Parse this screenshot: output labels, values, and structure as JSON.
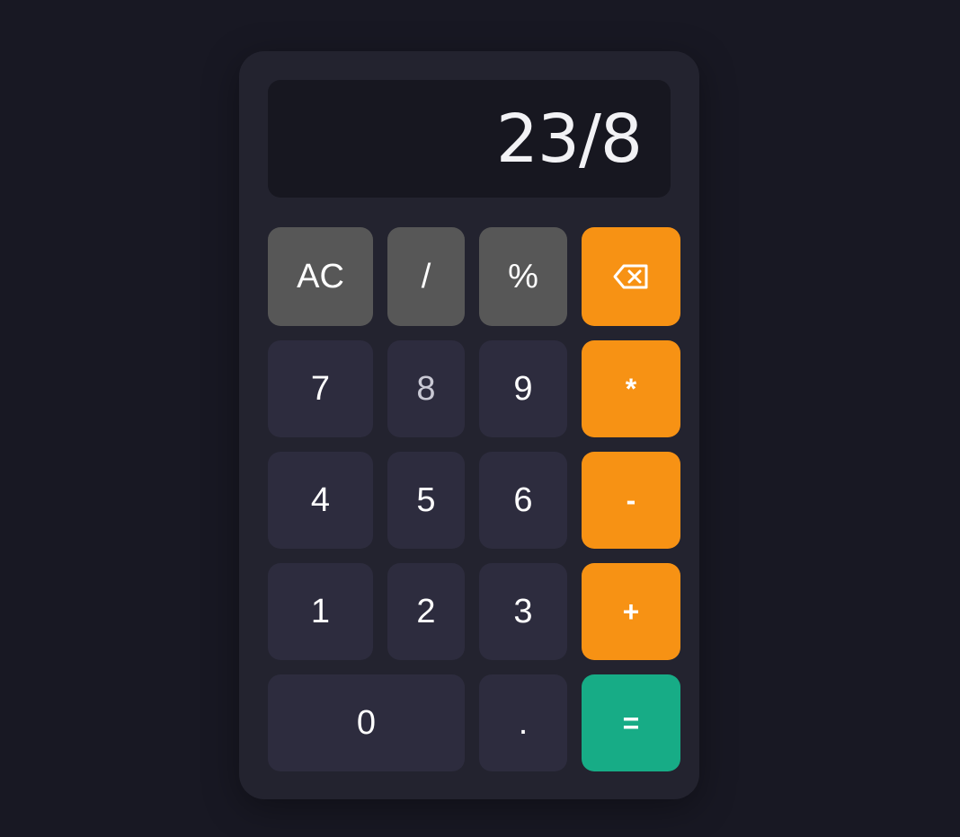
{
  "display": {
    "value": "23/8"
  },
  "keys": {
    "clear": "AC",
    "divide": "/",
    "percent": "%",
    "backspace_icon": "backspace-icon",
    "seven": "7",
    "eight": "8",
    "nine": "9",
    "multiply": "*",
    "four": "4",
    "five": "5",
    "six": "6",
    "subtract": "-",
    "one": "1",
    "two": "2",
    "three": "3",
    "add": "+",
    "zero": "0",
    "decimal": ".",
    "equals": "="
  },
  "colors": {
    "background": "#181823",
    "panel": "#23232f",
    "display": "#171720",
    "function_key": "#575757",
    "number_key": "#2d2c3e",
    "operator_key": "#f79214",
    "equals_key": "#17ac86"
  }
}
